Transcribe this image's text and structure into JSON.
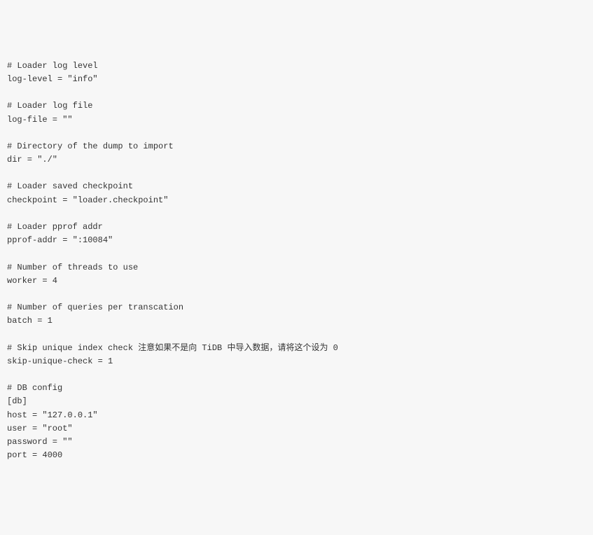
{
  "config": {
    "lines": [
      "# Loader log level",
      "log-level = \"info\"",
      "",
      "# Loader log file",
      "log-file = \"\"",
      "",
      "# Directory of the dump to import",
      "dir = \"./\"",
      "",
      "# Loader saved checkpoint",
      "checkpoint = \"loader.checkpoint\"",
      "",
      "# Loader pprof addr",
      "pprof-addr = \":10084\"",
      "",
      "# Number of threads to use",
      "worker = 4",
      "",
      "# Number of queries per transcation",
      "batch = 1",
      "",
      "# Skip unique index check 注意如果不是向 TiDB 中导入数据，请将这个设为 0",
      "skip-unique-check = 1",
      "",
      "# DB config",
      "[db]",
      "host = \"127.0.0.1\"",
      "user = \"root\"",
      "password = \"\"",
      "port = 4000"
    ]
  }
}
